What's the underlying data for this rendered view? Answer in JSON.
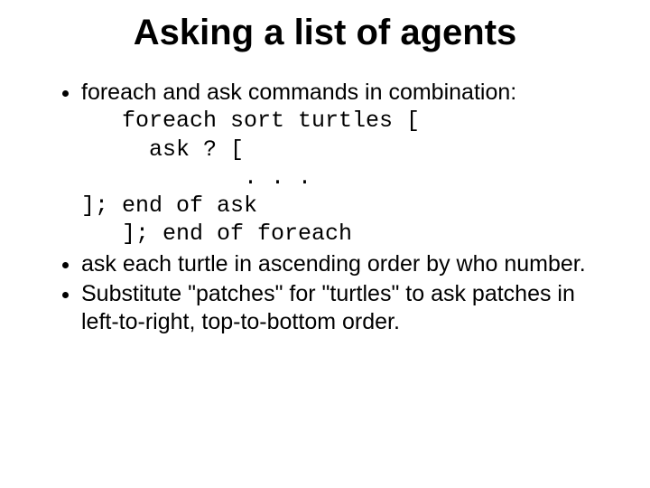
{
  "title": "Asking a list of agents",
  "bullets": [
    {
      "text": "foreach and ask commands in combination:",
      "code_lines": [
        "   foreach sort turtles [",
        "     ask ? [",
        "            . . .",
        "]; end of ask",
        "   ]; end of foreach"
      ]
    },
    {
      "text": "ask each turtle in ascending order by who number."
    },
    {
      "text": "Substitute \"patches\" for \"turtles\" to ask patches in left-to-right, top-to-bottom order."
    }
  ]
}
